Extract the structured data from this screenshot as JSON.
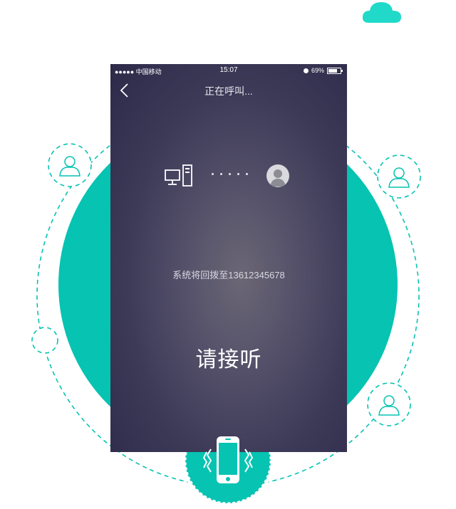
{
  "status_bar": {
    "signal": "●●●●● 中国移动",
    "time": "15:07",
    "battery": "69%",
    "battery_level": 0.69
  },
  "nav": {
    "title": "正在呼叫..."
  },
  "call": {
    "redial_notice": "系统将回拨至13612345678",
    "answer_prompt": "请接听"
  },
  "icons": {
    "back": "chevron-left-icon",
    "computer": "computer-icon",
    "avatar": "user-avatar-icon",
    "phone": "vibrating-phone-icon",
    "cloud": "cloud-icon",
    "person": "person-icon"
  },
  "colors": {
    "accent": "#06C3B2",
    "cloud": "#20D9C9",
    "screen_dark": "#2C2A49"
  }
}
